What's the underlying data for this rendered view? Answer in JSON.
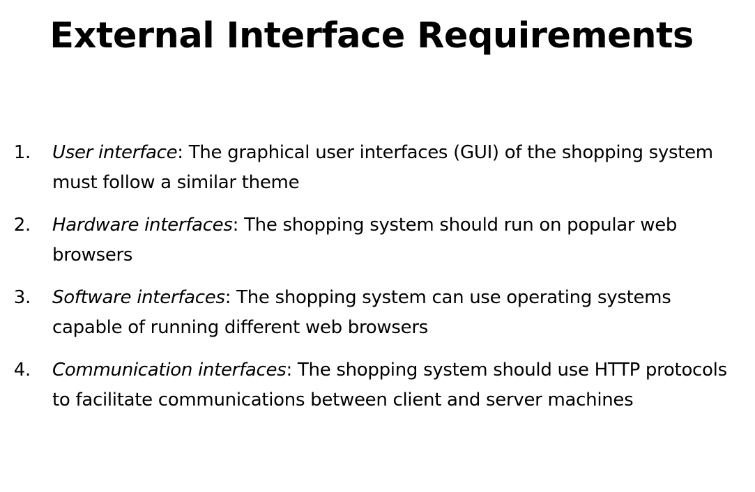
{
  "slide": {
    "title": "External Interface Requirements"
  },
  "requirements": [
    {
      "number": "1.",
      "term": "User interface",
      "separator": ":",
      "description": " The graphical user interfaces (GUI) of the shopping system must follow a similar theme"
    },
    {
      "number": "2.",
      "term": "Hardware interfaces",
      "separator": ":",
      "description": " The shopping system should run on popular web browsers"
    },
    {
      "number": "3.",
      "term": "Software interfaces",
      "separator": ":",
      "description": " The shopping system can use operating systems capable of running different web browsers"
    },
    {
      "number": "4.",
      "term": "Communication interfaces",
      "separator": ":",
      "description": " The shopping system should use HTTP protocols to facilitate communications between client and server machines"
    }
  ]
}
